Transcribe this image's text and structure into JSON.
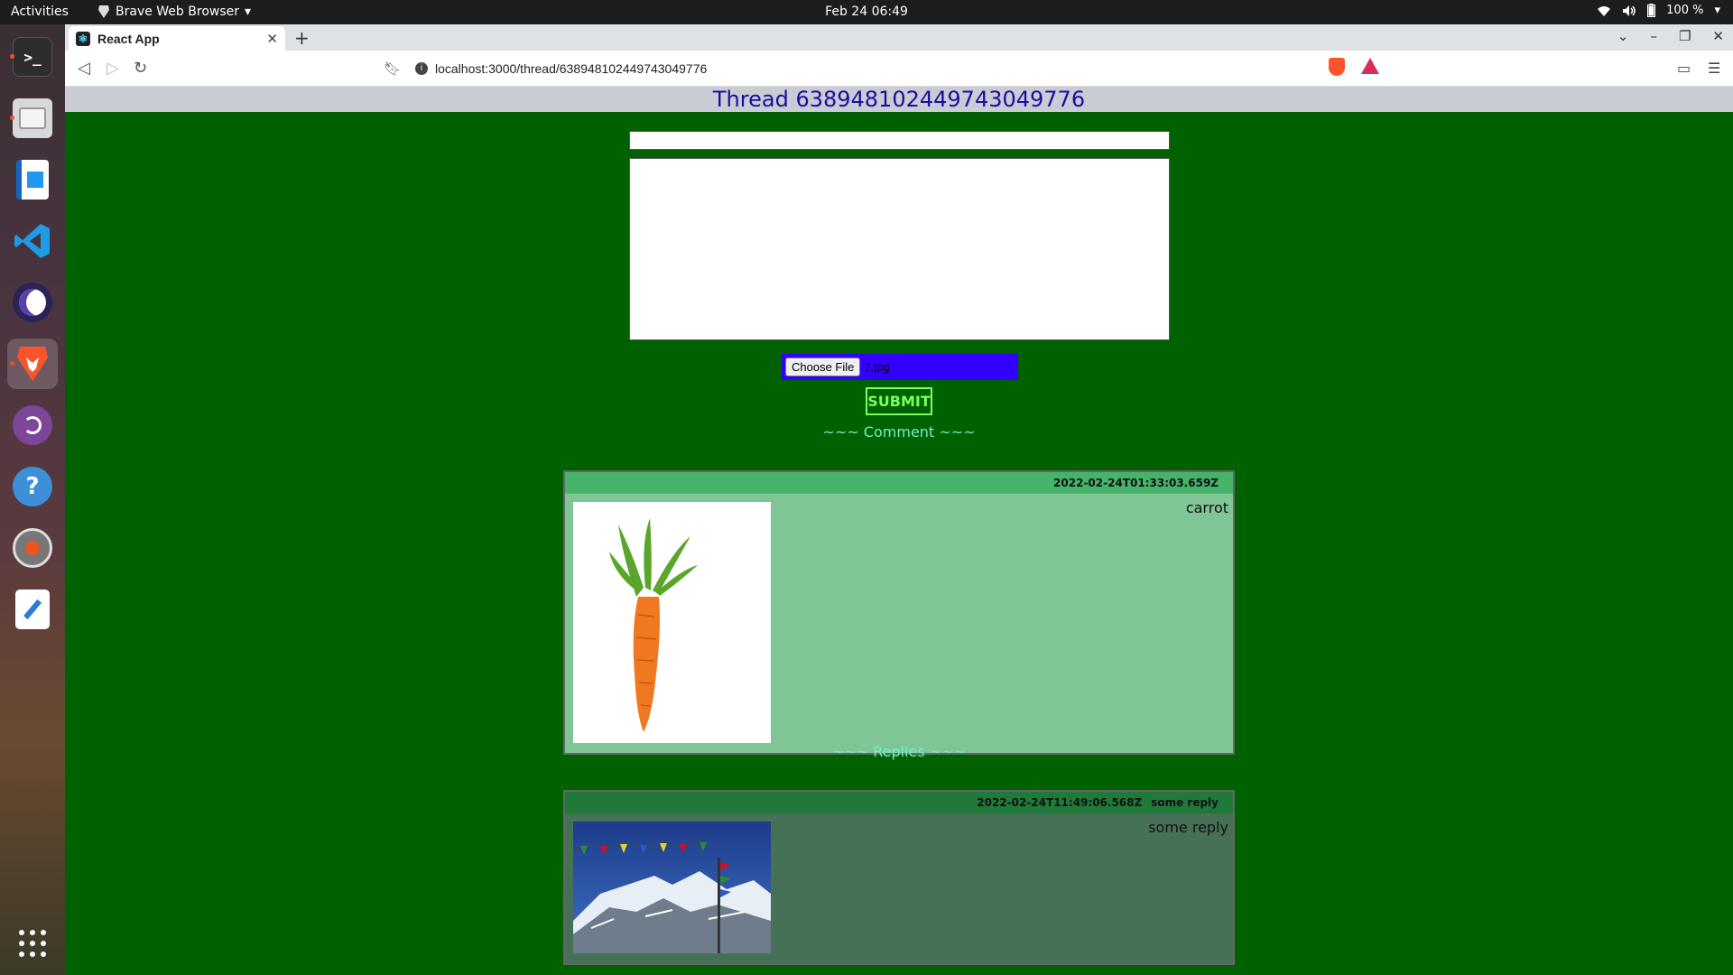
{
  "topbar": {
    "activities": "Activities",
    "app_name": "Brave Web Browser",
    "clock": "Feb 24  06:49",
    "battery": "100 %"
  },
  "dock": {
    "items": [
      "terminal-icon",
      "files-icon",
      "writer-icon",
      "vscode-icon",
      "eclipse-icon",
      "brave-icon",
      "tor-icon",
      "help-icon",
      "installer-icon",
      "text-editor-icon",
      "app-grid-icon"
    ]
  },
  "browser": {
    "tab_title": "React App",
    "url": "localhost:3000/thread/638948102449743049776"
  },
  "page": {
    "header": "Thread 638948102449743049776",
    "file_button": "Choose File",
    "file_name": "7.jpg",
    "submit": "SUBMIT",
    "comment_label": "~~~ Comment ~~~",
    "replies_label": "~~~ Replies ~~~",
    "comment": {
      "timestamp": "2022-02-24T01:33:03.659Z",
      "text": "carrot",
      "image": "carrot-image"
    },
    "reply": {
      "timestamp": "2022-02-24T11:49:06.568Z",
      "subject": "some reply",
      "text": "some reply",
      "image": "mountain-image"
    }
  },
  "colors": {
    "page_bg": "#006100",
    "header_text": "#1a0f9e",
    "file_bg": "#3300ff",
    "submit": "#7cff5e",
    "section_label": "#6ff0c8",
    "comment_bg": "#80c595",
    "comment_head": "#45b36a",
    "reply_bg": "#477156",
    "reply_head": "#1f7a3a"
  }
}
